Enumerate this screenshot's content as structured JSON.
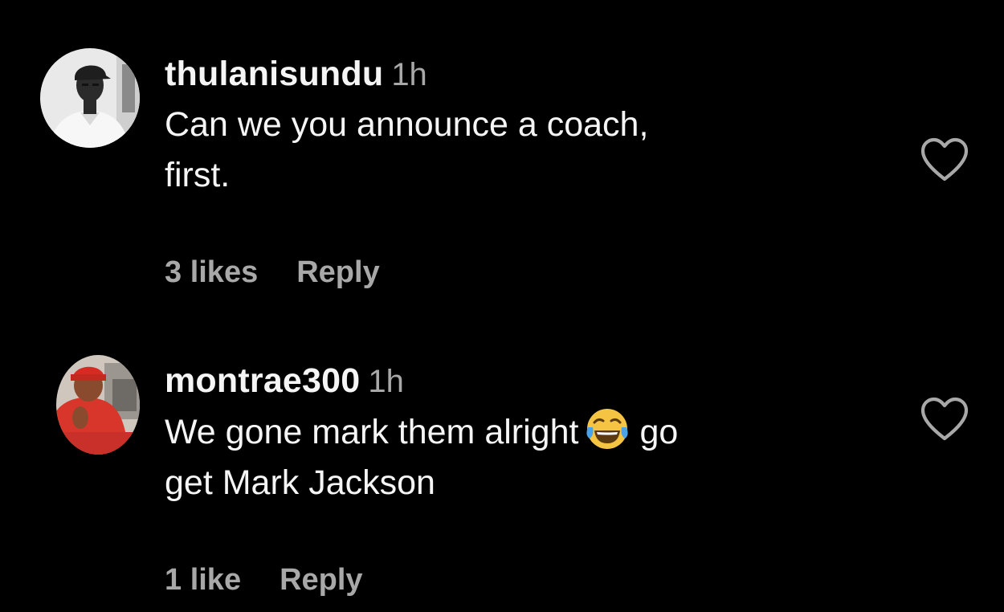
{
  "comments": [
    {
      "username": "thulanisundu",
      "time": "1h",
      "lines": [
        "Can we you announce a coach,",
        "first."
      ],
      "likes": "3 likes",
      "reply": "Reply",
      "liked": false
    },
    {
      "username": "montrae300",
      "time": "1h",
      "line1_before_emoji": "We gone mark them alright",
      "emoji": "face-with-tears-of-joy",
      "line1_after_emoji": "go",
      "line2": "get Mark Jackson",
      "likes": "1 like",
      "reply": "Reply",
      "liked": false
    }
  ],
  "colors": {
    "background": "#000000",
    "primary_text": "#f5f5f5",
    "secondary_text": "#a8a8a8"
  },
  "icons": {
    "like": "heart-outline-icon"
  }
}
